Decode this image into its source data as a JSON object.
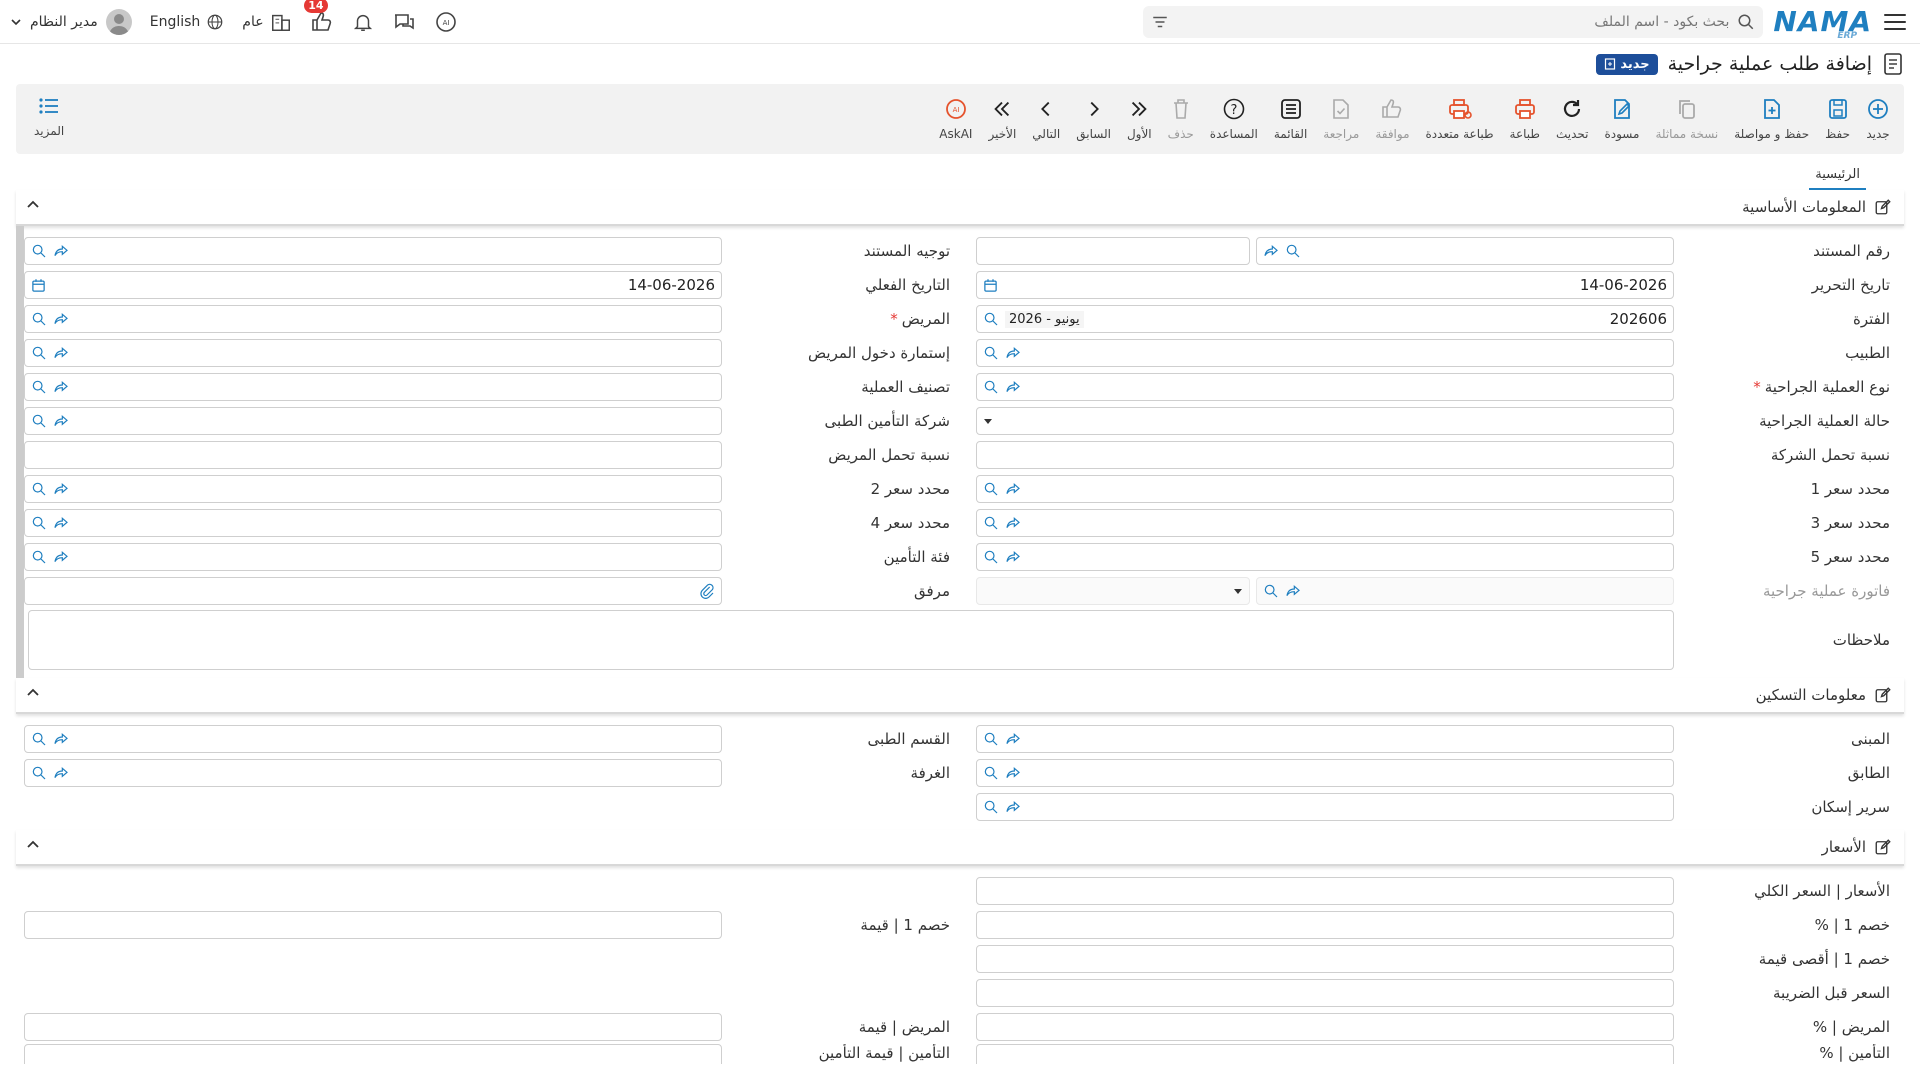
{
  "topbar": {
    "logo": "NAMA",
    "logo_sub": "ERP",
    "search_placeholder": "بحث بكود - اسم الملف",
    "user_name": "مدير النظام",
    "language": "English",
    "general": "عام",
    "notif_count": "14"
  },
  "page": {
    "title": "إضافة طلب عملية جراحية",
    "status": "جديد"
  },
  "toolbar": {
    "new": "جديد",
    "save": "حفظ",
    "save_continue": "حفظ و مواصلة",
    "copy": "نسخة مماثلة",
    "draft": "مسودة",
    "refresh": "تحديث",
    "print": "طباعة",
    "multi_print": "طباعة متعددة",
    "approve": "موافقة",
    "review": "مراجعة",
    "list": "القائمة",
    "help": "المساعدة",
    "delete": "حذف",
    "first": "الأول",
    "prev": "السابق",
    "next": "التالي",
    "last": "الأخير",
    "askai": "AskAI",
    "more": "المزيد"
  },
  "tabs": [
    "الرئيسية"
  ],
  "sections": {
    "basic": "المعلومات الأساسية",
    "housing": "معلومات التسكين",
    "prices": "الأسعار"
  },
  "basic": {
    "doc_number": "رقم المستند",
    "doc_direction": "توجيه المستند",
    "edit_date": "تاريخ التحرير",
    "edit_date_val": "14-06-2026",
    "actual_date": "التاريخ الفعلي",
    "actual_date_val": "14-06-2026",
    "period": "الفترة",
    "period_code": "202606",
    "period_name": "2026 - يونيو",
    "patient": "المريض",
    "doctor": "الطبيب",
    "admission_form": "إستمارة دخول المريض",
    "op_type": "نوع العملية الجراحية",
    "op_class": "تصنيف العملية",
    "op_status": "حالة العملية الجراحية",
    "insurance_co": "شركة التأمين الطبى",
    "company_share": "نسبة تحمل الشركة",
    "patient_share": "نسبة تحمل المريض",
    "price1": "محدد سعر 1",
    "price2": "محدد سعر 2",
    "price3": "محدد سعر 3",
    "price4": "محدد سعر 4",
    "price5": "محدد سعر 5",
    "ins_class": "فئة التأمين",
    "invoice": "فاتورة عملية جراحية",
    "attachment": "مرفق",
    "notes": "ملاحظات"
  },
  "housing": {
    "building": "المبنى",
    "department": "القسم الطبى",
    "floor": "الطابق",
    "room": "الغرفة",
    "bed": "سرير إسكان"
  },
  "prices": {
    "total": "الأسعار | السعر الكلي",
    "disc1_pct": "خصم 1 | %",
    "disc1_val": "خصم 1 | قيمة",
    "disc1_max": "خصم 1 | أقصى قيمة",
    "before_tax": "السعر قبل الضريبة",
    "patient_pct": "المريض | %",
    "patient_val": "المريض | قيمة",
    "ins_pct": "التأمين | %",
    "ins_val": "التأمين | قيمة التأمين"
  }
}
